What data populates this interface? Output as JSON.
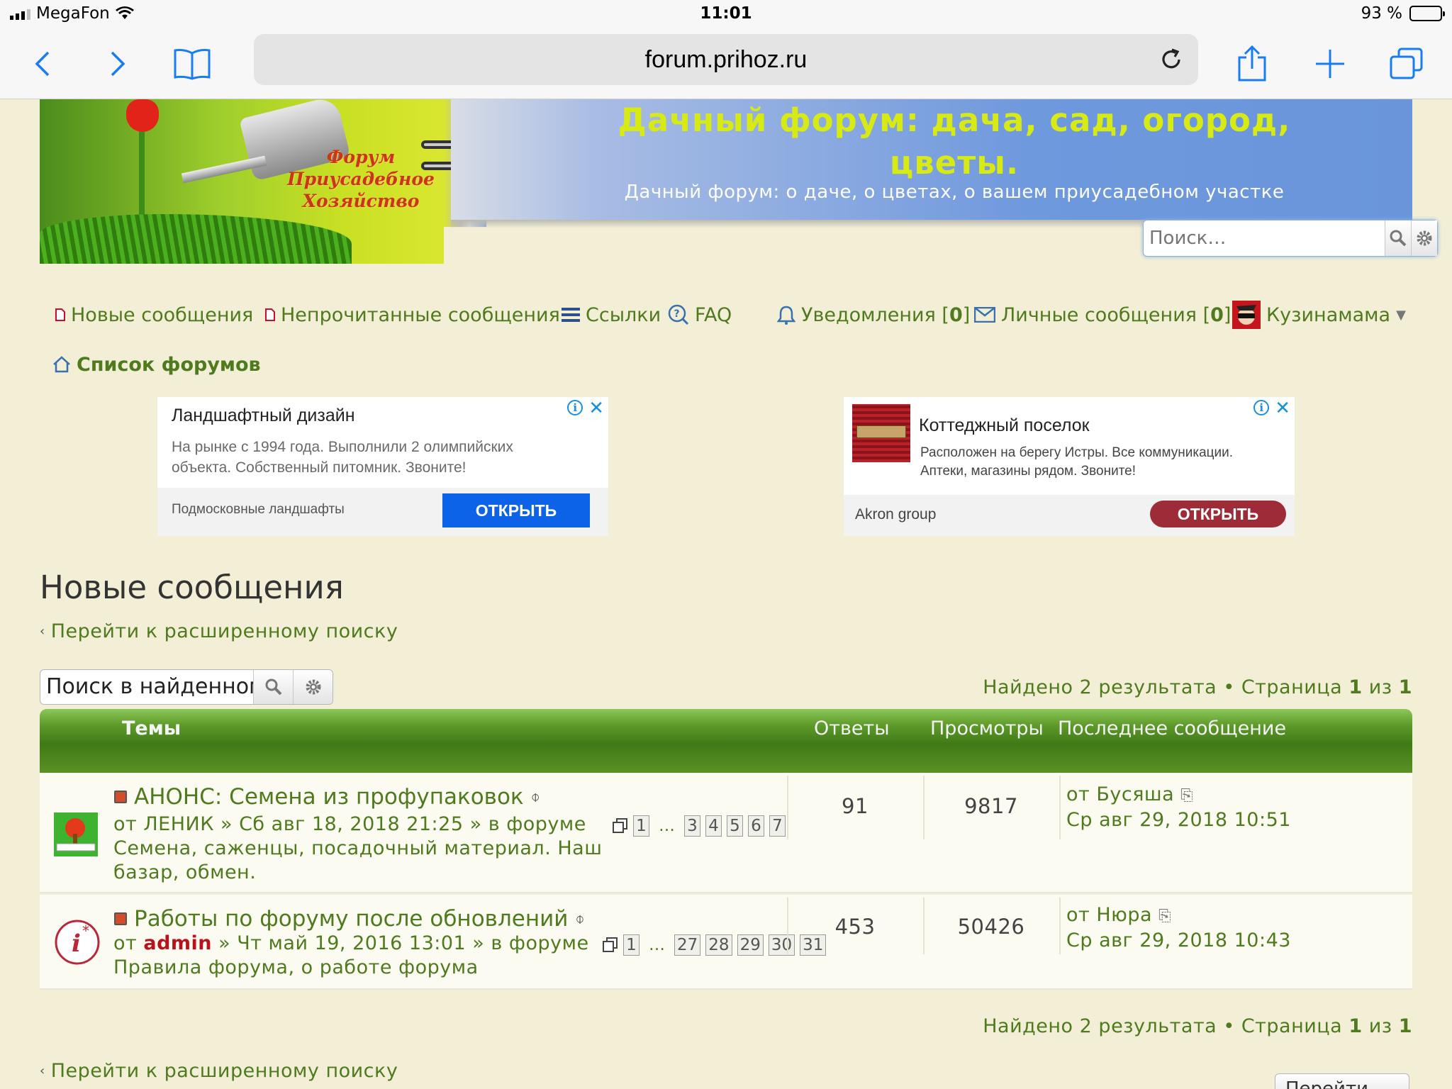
{
  "status_bar": {
    "carrier": "MegaFon",
    "time": "11:01",
    "battery": "93 %"
  },
  "browser": {
    "url": "forum.prihoz.ru"
  },
  "header": {
    "logo_text": [
      "Форум",
      "Приусадебное",
      "Хозяйство"
    ],
    "title": "Дачный форум: дача, сад, огород, цветы.",
    "description": "Дачный форум: о даче, о цветах, о вашем приусадебном участке",
    "search_placeholder": "Поиск…"
  },
  "nav": {
    "new_posts": "Новые сообщения",
    "unread_posts": "Непрочитанные сообщения",
    "links": "Ссылки",
    "faq": "FAQ",
    "notifications": "Уведомления",
    "notifications_count": "0",
    "private_messages": "Личные сообщения",
    "private_messages_count": "0",
    "username": "Кузинамама",
    "forum_index": "Список форумов"
  },
  "ads": [
    {
      "title": "Ландшафтный дизайн",
      "text": "На рынке с 1994 года. Выполнили 2 олимпийских объекта. Собственный питомник. Звоните!",
      "advertiser": "Подмосковные ландшафты",
      "button": "ОТКРЫТЬ",
      "button_color": "#0c63e7"
    },
    {
      "title": "Коттеджный поселок",
      "text": "Расположен на берегу Истры. Все коммуникации. Аптеки, магазины рядом. Звоните!",
      "advertiser": "Akron group",
      "button": "ОТКРЫТЬ",
      "button_color": "#9e2c38"
    }
  ],
  "main": {
    "heading": "Новые сообщения",
    "advanced_search": "Перейти к расширенному поиску",
    "inner_search_placeholder": "Поиск в найденном…",
    "results_prefix": "Найдено 2 результата",
    "page_word": "Страница",
    "page_current": "1",
    "page_of": "из",
    "page_total": "1",
    "columns": {
      "topics": "Темы",
      "replies": "Ответы",
      "views": "Просмотры",
      "last_post": "Последнее сообщение"
    },
    "topics": [
      {
        "title": "АНОНС: Семена из профупаковок",
        "by": "от",
        "author": "ЛЕНИК",
        "date": "» Сб авг 18, 2018 21:25 » в форуме",
        "forum": "Семена, саженцы, посадочный материал. Наш базар, обмен.",
        "pages": [
          "1",
          "…",
          "3",
          "4",
          "5",
          "6",
          "7"
        ],
        "replies": "91",
        "views": "9817",
        "last_by": "от",
        "last_author": "Бусяша",
        "last_date": "Ср авг 29, 2018 10:51"
      },
      {
        "title": "Работы по форуму после обновлений",
        "by": "от",
        "author": "admin",
        "date": "» Чт май 19, 2016 13:01 » в форуме",
        "forum": "Правила форума, о работе форума",
        "pages": [
          "1",
          "…",
          "27",
          "28",
          "29",
          "30",
          "31"
        ],
        "replies": "453",
        "views": "50426",
        "last_by": "от",
        "last_author": "Нюра",
        "last_date": "Ср авг 29, 2018 10:43"
      }
    ],
    "goto_button": "Перейти"
  },
  "colors": {
    "link_green": "#4f7a1e",
    "header_green": "#4a8a1c",
    "title_yellow": "#d7ea14",
    "admin_red": "#b8121b"
  }
}
